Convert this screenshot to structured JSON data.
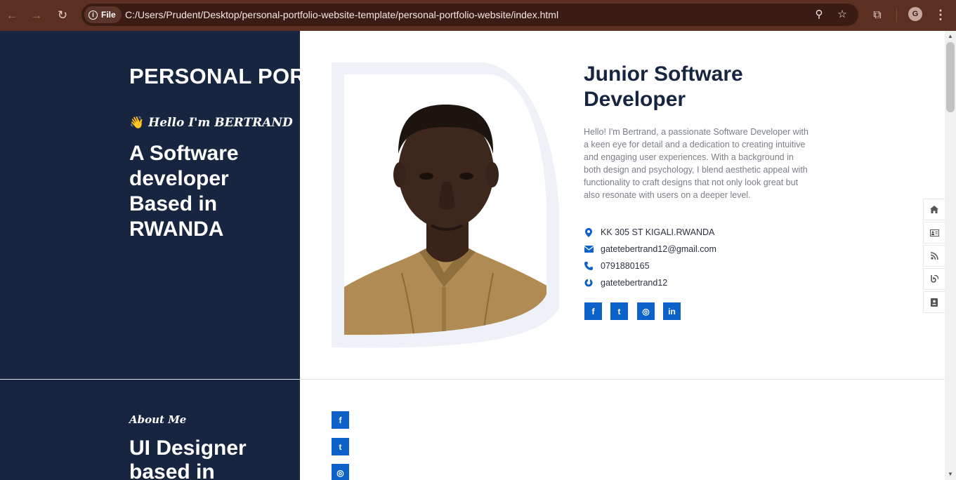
{
  "browser": {
    "back_glyph": "←",
    "forward_glyph": "→",
    "reload_glyph": "↻",
    "file_label": "File",
    "info_glyph": "i",
    "url": "C:/Users/Prudent/Desktop/personal-portfolio-website-template/personal-portfolio-website/index.html",
    "zoom_glyph": "⚲",
    "star_glyph": "☆",
    "extensions_glyph": "⧉",
    "profile_initial": "G",
    "menu_glyph": "⋮",
    "icons": [
      "back-icon",
      "forward-icon",
      "reload-icon",
      "info-icon",
      "zoom-icon",
      "star-icon",
      "extensions-icon",
      "menu-icon"
    ]
  },
  "sidebar": {
    "brand": "PERSONAL PORTFOLIO",
    "greeting_emoji": "👋",
    "greeting": "Hello I'm BERTRAND",
    "hero_title": "A Software developer Based in RWANDA",
    "about_eyebrow": "About Me",
    "about_title": "UI Designer based in"
  },
  "profile": {
    "job_title": "Junior Software Developer",
    "bio": "Hello! I'm Bertrand, a passionate Software Developer with a keen eye for detail and a dedication to creating intuitive and engaging user experiences. With a background in both design and psychology, I blend aesthetic appeal with functionality to craft designs that not only look great but also resonate with users on a deeper level.",
    "contacts": [
      {
        "icon": "map-marker-icon",
        "text": "KK 305 ST KIGALI.RWANDA"
      },
      {
        "icon": "envelope-icon",
        "text": "gatetebertrand12@gmail.com"
      },
      {
        "icon": "phone-icon",
        "text": "0791880165"
      },
      {
        "icon": "skype-icon",
        "text": "gatetebertrand12"
      }
    ],
    "socials": [
      {
        "icon": "facebook-icon",
        "glyph": "f"
      },
      {
        "icon": "twitter-icon",
        "glyph": "t"
      },
      {
        "icon": "instagram-icon",
        "glyph": "◎"
      },
      {
        "icon": "linkedin-icon",
        "glyph": "in"
      }
    ]
  },
  "about": {
    "socials": [
      {
        "icon": "facebook-icon",
        "glyph": "f"
      },
      {
        "icon": "twitter-icon",
        "glyph": "t"
      },
      {
        "icon": "instagram-icon",
        "glyph": "◎"
      }
    ]
  },
  "side_nav": [
    "home-icon",
    "id-card-icon",
    "rss-icon",
    "blog-icon",
    "contact-book-icon"
  ],
  "colors": {
    "sidebar_bg": "#172540",
    "accent": "#0d62c9",
    "heading": "#172540",
    "chrome": "#5b2f22"
  }
}
